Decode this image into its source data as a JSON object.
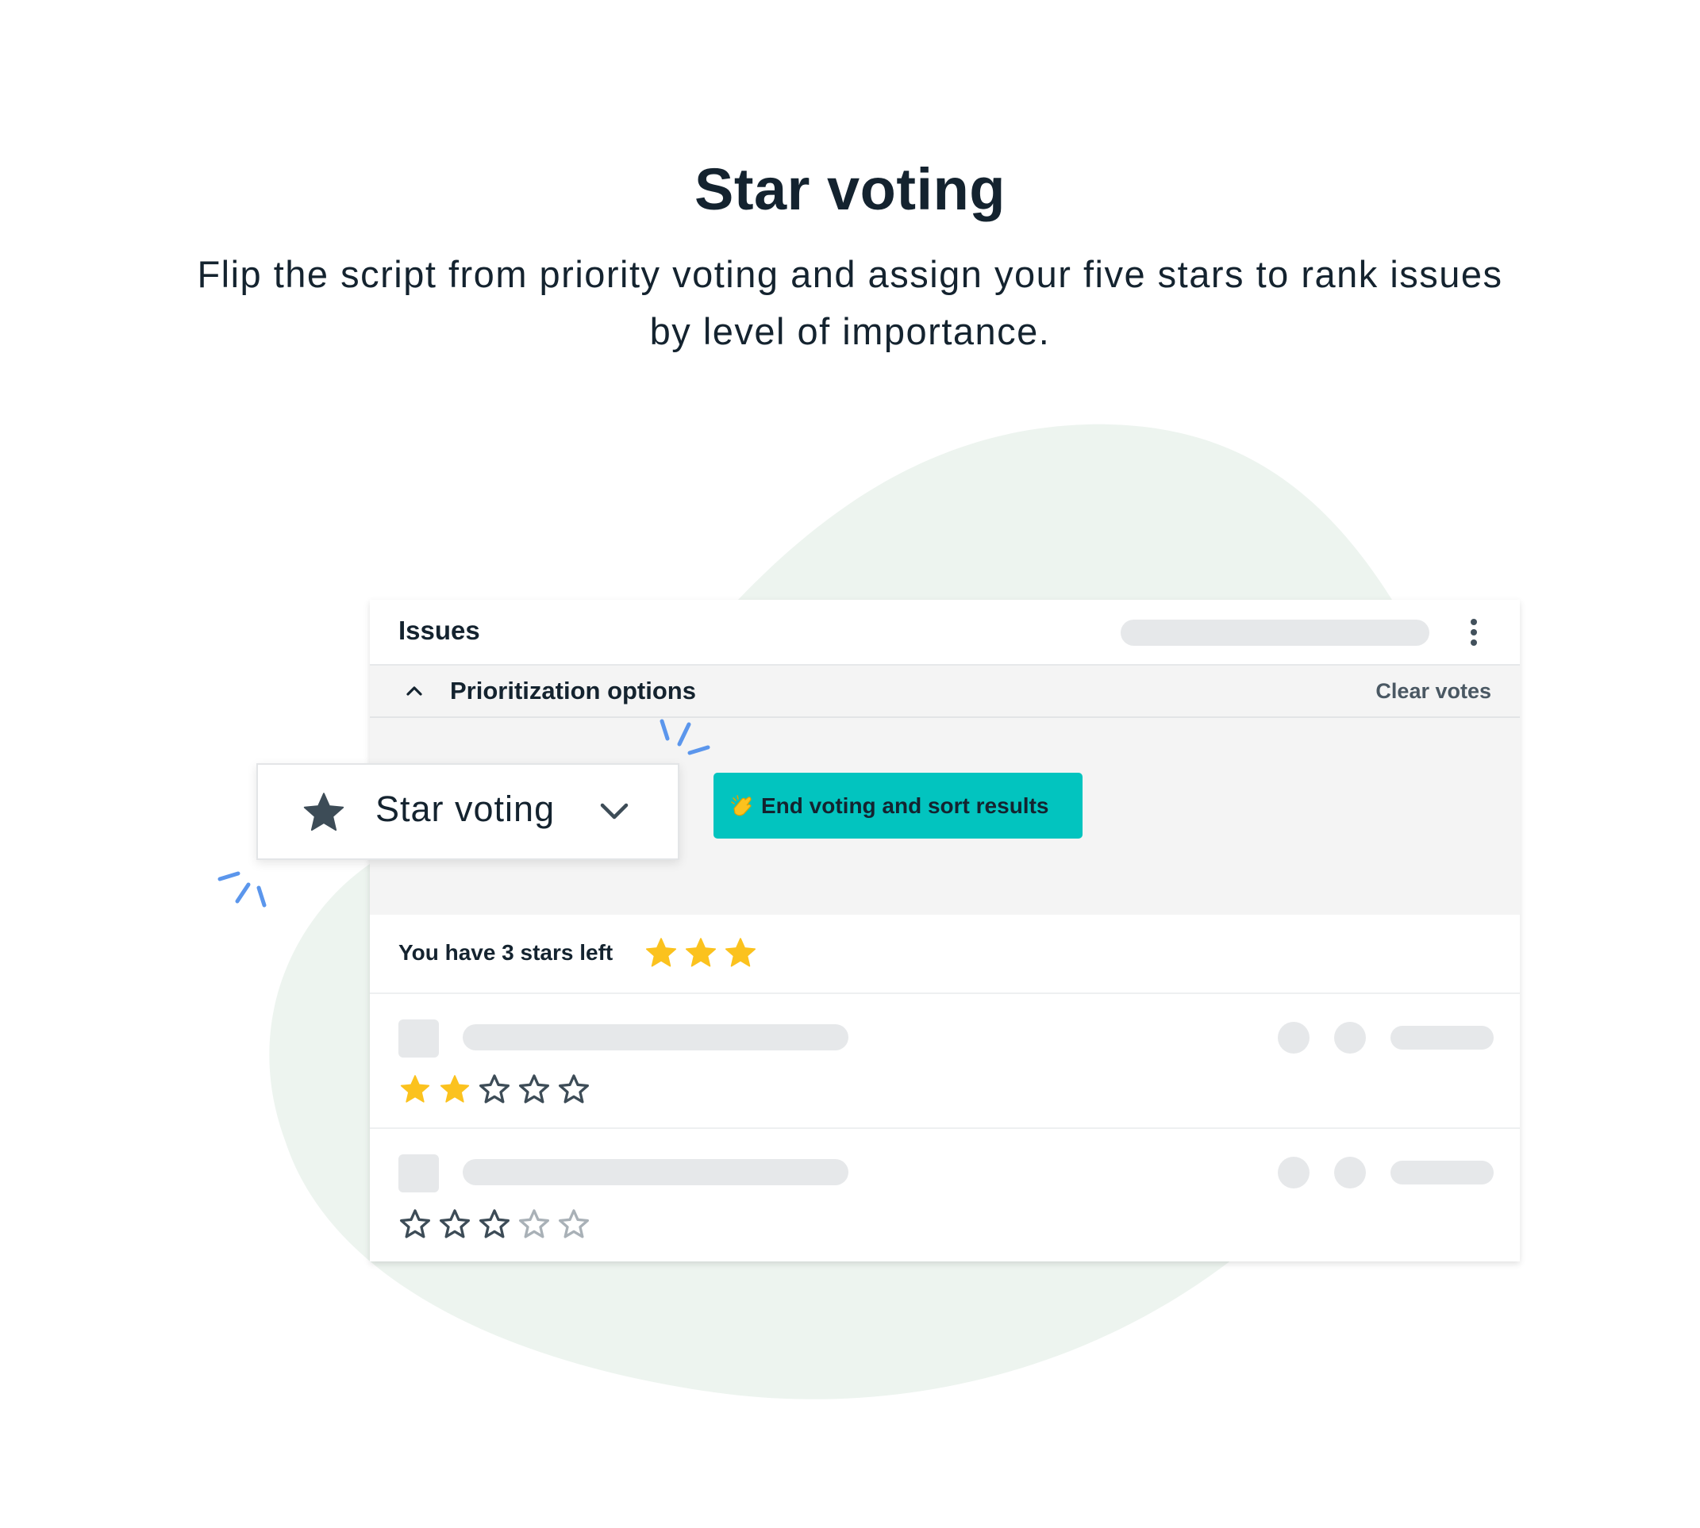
{
  "hero": {
    "title": "Star voting",
    "subtitle": "Flip the script from priority voting and assign your five stars to rank issues by level of importance."
  },
  "panel": {
    "title": "Issues",
    "prioritization": {
      "title": "Prioritization options",
      "clear_votes_label": "Clear votes",
      "end_voting_label": "End voting and sort results"
    },
    "voting_method": {
      "selected": "Star voting",
      "icon": "star-icon"
    },
    "stars_left": {
      "label": "You have 3 stars left",
      "count": 3
    },
    "issues": [
      {
        "rating": 2,
        "max_rating": 5,
        "enabled_stars": 5
      },
      {
        "rating": 0,
        "max_rating": 5,
        "enabled_stars": 3
      }
    ]
  },
  "colors": {
    "accent": "#02c4bf",
    "star_filled": "#fbc21e",
    "text": "#14232f",
    "blob": "#edf4ef",
    "sparkle": "#5b96ec"
  }
}
